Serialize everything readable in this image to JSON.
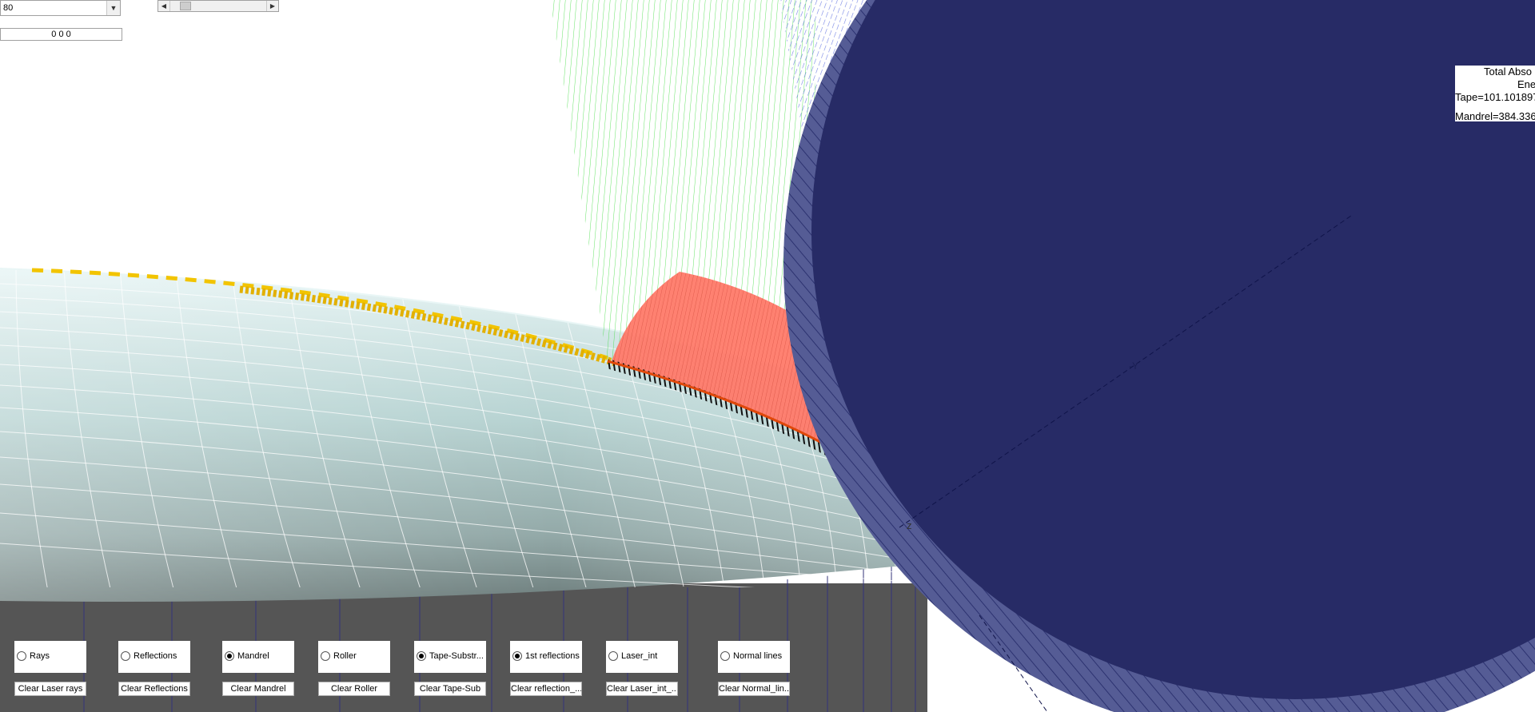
{
  "top_controls": {
    "dropdown_value": "80",
    "coord_field_value": "0 0 0",
    "slider_position": 0.12
  },
  "energy_panel": {
    "line1": "Total Abso",
    "line2": "Ene",
    "line3": "Tape=101.101897",
    "line4": "Mandrel=384.336"
  },
  "axis_labels": {
    "z": "z",
    "y": "-Y"
  },
  "toggles": [
    {
      "label": "Rays",
      "checked": false,
      "clear_label": "Clear Laser rays"
    },
    {
      "label": "Reflections",
      "checked": false,
      "clear_label": "Clear Reflections"
    },
    {
      "label": "Mandrel",
      "checked": true,
      "clear_label": "Clear Mandrel"
    },
    {
      "label": "Roller",
      "checked": false,
      "clear_label": "Clear Roller"
    },
    {
      "label": "Tape-Substr...",
      "checked": true,
      "clear_label": "Clear Tape-Sub"
    },
    {
      "label": "1st reflections",
      "checked": true,
      "clear_label": "Clear reflection_..."
    },
    {
      "label": "Laser_int",
      "checked": false,
      "clear_label": "Clear Laser_int_..."
    },
    {
      "label": "Normal lines",
      "checked": false,
      "clear_label": "Clear Normal_lin..."
    }
  ],
  "colors": {
    "roller": "#272b66",
    "mandrel_top": "#b5d2d2",
    "mandrel_side": "#555555",
    "laser_rays": "#3ddc3d",
    "reflections": "#6a78e0",
    "tape_band": "#f2c400",
    "intensity": "#ff6a5a"
  }
}
